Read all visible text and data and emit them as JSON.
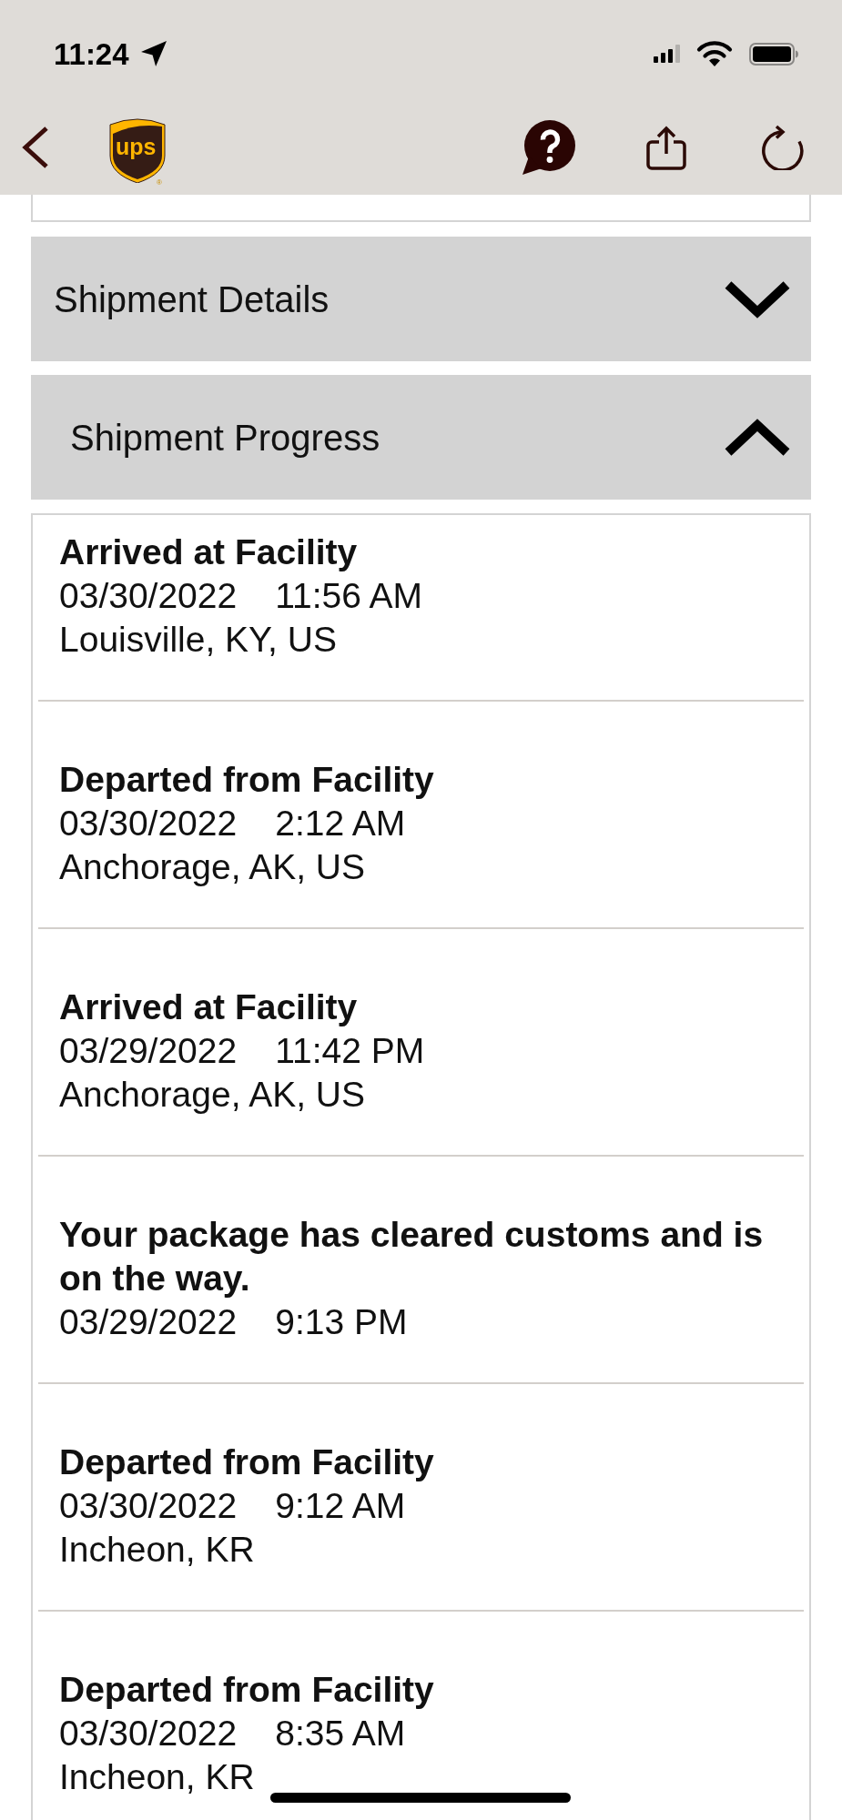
{
  "status_bar": {
    "time": "11:24"
  },
  "nav_bar": {
    "logo": {
      "text": "ups",
      "mark": "®"
    }
  },
  "sections": [
    {
      "title": "Shipment Details",
      "expanded": false
    },
    {
      "title": "Shipment Progress",
      "expanded": true,
      "events": [
        {
          "title": "Arrived at Facility",
          "date": "03/30/2022",
          "time": "11:56 AM",
          "location": "Louisville, KY, US"
        },
        {
          "title": "Departed from Facility",
          "date": "03/30/2022",
          "time": "2:12 AM",
          "location": "Anchorage, AK, US"
        },
        {
          "title": "Arrived at Facility",
          "date": "03/29/2022",
          "time": "11:42 PM",
          "location": "Anchorage, AK, US"
        },
        {
          "title": "Your package has cleared customs and is on the way.",
          "date": "03/29/2022",
          "time": "9:13 PM"
        },
        {
          "title": "Departed from Facility",
          "date": "03/30/2022",
          "time": "9:12 AM",
          "location": "Incheon, KR"
        },
        {
          "title": "Departed from Facility",
          "date": "03/30/2022",
          "time": "8:35 AM",
          "location": "Incheon, KR"
        }
      ]
    }
  ]
}
